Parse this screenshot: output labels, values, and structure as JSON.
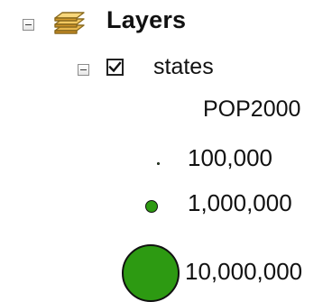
{
  "toc": {
    "root": {
      "label": "Layers",
      "icon": "layers-stack-icon",
      "expanded": true
    },
    "layer": {
      "label": "states",
      "visible": true,
      "expanded": true
    },
    "legend": {
      "field": "POP2000",
      "symbol_color": "#2d9a12",
      "classes": [
        {
          "label": "100,000"
        },
        {
          "label": "1,000,000"
        },
        {
          "label": "10,000,000"
        }
      ]
    }
  }
}
